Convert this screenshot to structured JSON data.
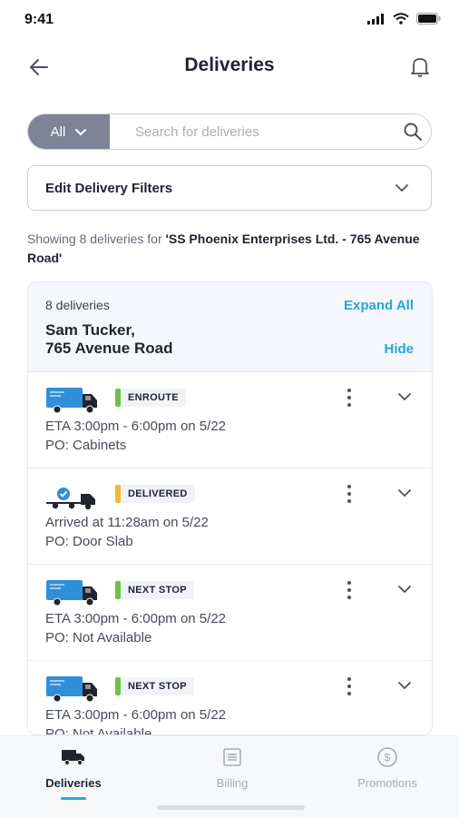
{
  "status_bar": {
    "time": "9:41"
  },
  "header": {
    "title": "Deliveries"
  },
  "search": {
    "scope": "All",
    "placeholder": "Search for deliveries",
    "value": ""
  },
  "filters": {
    "label": "Edit Delivery Filters"
  },
  "summary": {
    "prefix": "Showing 8 deliveries for ",
    "location": "'SS Phoenix Enterprises Ltd. - 765 Avenue Road'"
  },
  "group": {
    "count": "8 deliveries",
    "expand_all": "Expand All",
    "customer_line1": "Sam Tucker,",
    "customer_line2": "765 Avenue Road",
    "hide": "Hide"
  },
  "deliveries": [
    {
      "status": "ENROUTE",
      "status_color": "#6cc24a",
      "line1": "ETA 3:00pm - 6:00pm on 5/22",
      "line2": "PO: Cabinets",
      "icon": "truck-icon"
    },
    {
      "status": "DELIVERED",
      "status_color": "#f5b82e",
      "line1": "Arrived at 11:28am on 5/22",
      "line2": "PO: Door Slab",
      "icon": "delivered-truck-icon"
    },
    {
      "status": "NEXT STOP",
      "status_color": "#6cc24a",
      "line1": "ETA 3:00pm - 6:00pm on 5/22",
      "line2": "PO: Not Available",
      "icon": "truck-icon"
    },
    {
      "status": "NEXT STOP",
      "status_color": "#6cc24a",
      "line1": "ETA 3:00pm - 6:00pm on 5/22",
      "line2": "PO: Not Available",
      "icon": "truck-icon"
    }
  ],
  "tabs": [
    {
      "label": "Deliveries",
      "icon": "truck-icon",
      "active": true
    },
    {
      "label": "Billing",
      "icon": "receipt-icon",
      "active": false
    },
    {
      "label": "Promotions",
      "icon": "dollar-badge-icon",
      "active": false
    }
  ],
  "colors": {
    "accent": "#27a6d6",
    "truck_blue": "#2f8fd8",
    "scope_bg": "#7c8495"
  }
}
